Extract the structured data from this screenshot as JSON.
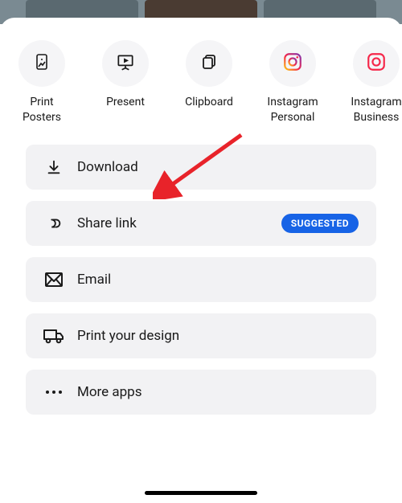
{
  "share_targets": [
    {
      "name": "print-posters",
      "label": "Print\nPosters",
      "icon": "poster-icon"
    },
    {
      "name": "present",
      "label": "Present",
      "icon": "present-icon"
    },
    {
      "name": "clipboard",
      "label": "Clipboard",
      "icon": "clipboard-icon"
    },
    {
      "name": "instagram-personal",
      "label": "Instagram\nPersonal",
      "icon": "instagram-icon"
    },
    {
      "name": "instagram-business",
      "label": "Instagram\nBusiness",
      "icon": "instagram-icon"
    }
  ],
  "actions": {
    "download": {
      "label": "Download"
    },
    "share_link": {
      "label": "Share link",
      "badge": "SUGGESTED"
    },
    "email": {
      "label": "Email"
    },
    "print_design": {
      "label": "Print your design"
    },
    "more_apps": {
      "label": "More apps"
    }
  },
  "colors": {
    "badge_bg": "#1763e6",
    "action_bg": "#f2f2f4"
  }
}
